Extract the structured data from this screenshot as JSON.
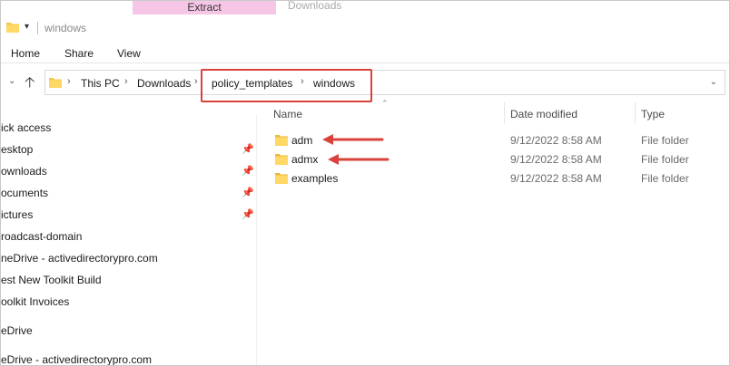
{
  "window": {
    "title": "windows",
    "context_tab": "Extract",
    "next_tab": "Downloads"
  },
  "ribbon": {
    "tabs": [
      "Home",
      "Share",
      "View"
    ]
  },
  "address": {
    "crumbs": [
      "This PC",
      "Downloads",
      "policy_templates",
      "windows"
    ]
  },
  "columns": {
    "name": "Name",
    "date": "Date modified",
    "type": "Type"
  },
  "files": [
    {
      "name": "adm",
      "date": "9/12/2022 8:58 AM",
      "type": "File folder"
    },
    {
      "name": "admx",
      "date": "9/12/2022 8:58 AM",
      "type": "File folder"
    },
    {
      "name": "examples",
      "date": "9/12/2022 8:58 AM",
      "type": "File folder"
    }
  ],
  "nav": [
    {
      "label": "ick access",
      "pinned": false
    },
    {
      "label": "esktop",
      "pinned": true
    },
    {
      "label": "ownloads",
      "pinned": true
    },
    {
      "label": "ocuments",
      "pinned": true
    },
    {
      "label": "ictures",
      "pinned": true
    },
    {
      "label": "roadcast-domain",
      "pinned": false
    },
    {
      "label": "neDrive - activedirectorypro.com",
      "pinned": false
    },
    {
      "label": "est New Toolkit Build",
      "pinned": false
    },
    {
      "label": "oolkit Invoices",
      "pinned": false
    },
    {
      "label": "eDrive",
      "pinned": false
    },
    {
      "label": "eDrive - activedirectorypro.com",
      "pinned": false
    }
  ],
  "colors": {
    "folder": "#f3c74e",
    "highlight": "#d9423a",
    "context_tab": "#f6c6e6"
  },
  "icons": {
    "folder": "folder-icon",
    "pin": "pin-icon",
    "up": "up-arrow-icon",
    "chevron": "chevron-right-icon",
    "dropdown": "chevron-down-icon"
  }
}
